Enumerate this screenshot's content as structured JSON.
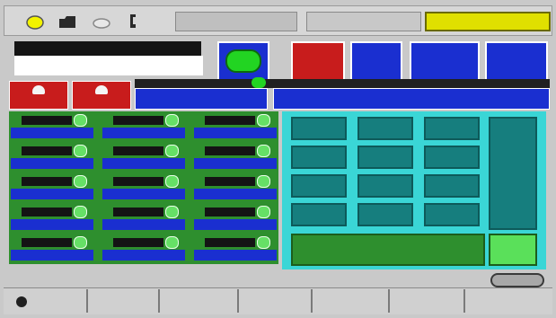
{
  "topbar": {
    "icons": [
      "yellow-lamp-icon",
      "folder-icon",
      "cloud-icon",
      "phone-icon"
    ],
    "status_text": "",
    "colors": {
      "status_bg": "#e0e000",
      "panel": "#d7d7d7"
    }
  },
  "header": {
    "title": "",
    "buttons": [
      {
        "label": "",
        "color": "#1a2fd0"
      },
      {
        "label": "",
        "color": "#c81c1c"
      },
      {
        "label": "",
        "color": "#1a2fd0"
      },
      {
        "label": "",
        "color": "#1a2fd0"
      },
      {
        "label": "",
        "color": "#1a2fd0"
      }
    ]
  },
  "left_grid": {
    "rows": 5,
    "cols": 3,
    "cell_color": "#2e8f2e",
    "bar_color": "#1a2fd0"
  },
  "keypad": {
    "enter_label": "",
    "panel_color": "#3ad6d6",
    "key_color": "#167e7e"
  },
  "bottom": {
    "segments": 7
  }
}
